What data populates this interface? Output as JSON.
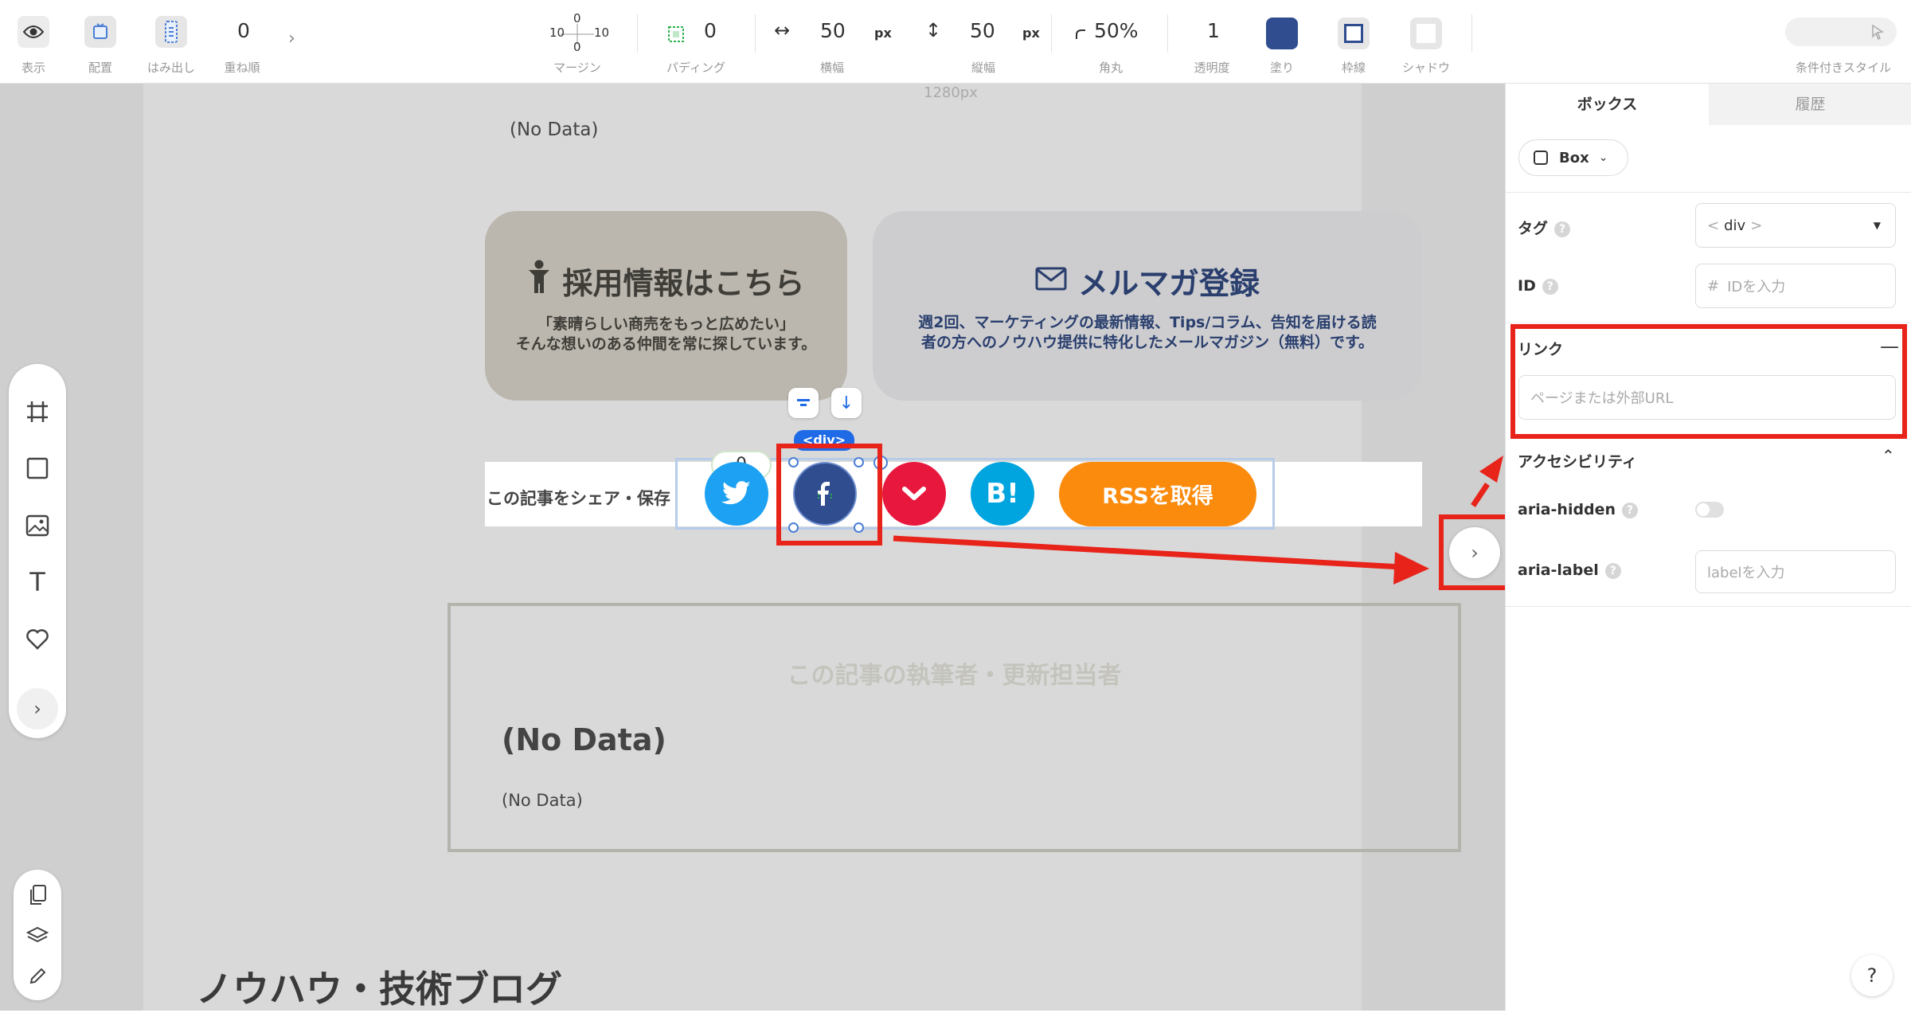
{
  "toolbar": {
    "display_label": "表示",
    "placement_label": "配置",
    "overflow_label": "はみ出し",
    "zorder_value": "0",
    "zorder_label": "重ね順",
    "margin": {
      "top": "0",
      "left": "10",
      "right": "10",
      "bottom": "0",
      "label": "マージン"
    },
    "padding": {
      "value": "0",
      "label": "パディング"
    },
    "width": {
      "value": "50",
      "unit": "px",
      "label": "横幅"
    },
    "height": {
      "value": "50",
      "unit": "px",
      "label": "縦幅"
    },
    "radius": {
      "value": "50%",
      "label": "角丸"
    },
    "opacity": {
      "value": "1",
      "label": "透明度"
    },
    "fill_label": "塗り",
    "border_label": "枠線",
    "shadow_label": "シャドウ",
    "conditional_label": "条件付きスタイル",
    "fill_color": "#2f4d8f"
  },
  "canvas": {
    "width_indicator": "1280px",
    "top_nodata": "(No Data)",
    "recruit_card": {
      "title": "採用情報はこちら",
      "desc": "「素晴らしい商売をもっと広めたい」\nそんな想いのある仲間を常に探しています。",
      "icon": "person-icon"
    },
    "newsletter_card": {
      "title": "メルマガ登録",
      "desc": "週2回、マーケティングの最新情報、Tips/コラム、告知を届ける読\n者の方へのノウハウ提供に特化したメールマガジン（無料）です。",
      "icon": "mail-icon"
    },
    "div_tag": "<div>",
    "share_label": "この記事をシェア・保存",
    "share_count": "0",
    "hatena_label": "B!",
    "rss_label": "RSSを取得",
    "author_heading": "この記事の執筆者・更新担当者",
    "author_name": "(No Data)",
    "author_text": "(No Data)",
    "blog_heading": "ノウハウ・技術ブログ",
    "colors": {
      "twitter": "#1da1f2",
      "facebook": "#3b5998",
      "pocket": "#e8173d",
      "hatena": "#00a4de",
      "rss": "#fb8b0d",
      "highlight": "#e8231a"
    }
  },
  "panel": {
    "tabs": [
      "ボックス",
      "履歴"
    ],
    "component": "Box",
    "tag_label": "タグ",
    "tag_value": "div",
    "id_label": "ID",
    "id_placeholder": "IDを入力",
    "link_label": "リンク",
    "link_placeholder": "ページまたは外部URL",
    "a11y_label": "アクセシビリティ",
    "aria_hidden_label": "aria-hidden",
    "aria_label_label": "aria-label",
    "aria_label_placeholder": "labelを入力",
    "help_button": "?"
  }
}
